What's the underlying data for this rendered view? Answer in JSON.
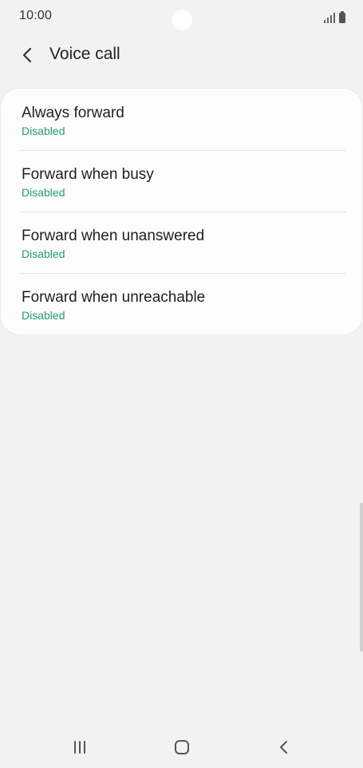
{
  "status_bar": {
    "time": "10:00"
  },
  "header": {
    "title": "Voice call",
    "back_icon": "chevron-left-icon"
  },
  "forward_options": [
    {
      "title": "Always forward",
      "status": "Disabled"
    },
    {
      "title": "Forward when busy",
      "status": "Disabled"
    },
    {
      "title": "Forward when unanswered",
      "status": "Disabled"
    },
    {
      "title": "Forward when unreachable",
      "status": "Disabled"
    }
  ],
  "nav_bar": {
    "recents_icon": "recent-apps-icon",
    "home_icon": "home-icon",
    "back_icon": "back-icon"
  },
  "colors": {
    "background": "#f2f2f2",
    "card": "#fdfdfd",
    "status_green": "#1f9f6b",
    "text_primary": "#1f1f1f"
  }
}
